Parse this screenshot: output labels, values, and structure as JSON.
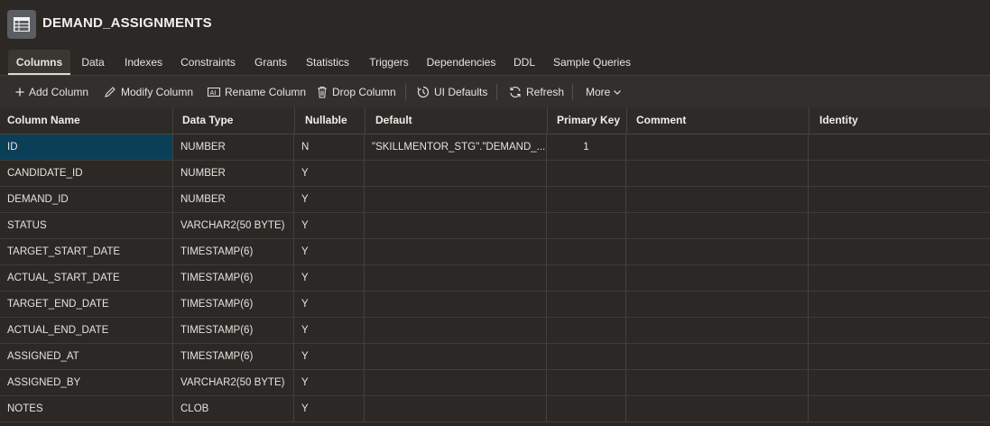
{
  "header": {
    "title": "DEMAND_ASSIGNMENTS",
    "icon": "table-icon"
  },
  "tabs": [
    "Columns",
    "Data",
    "Indexes",
    "Constraints",
    "Grants",
    "Statistics",
    "Triggers",
    "Dependencies",
    "DDL",
    "Sample Queries"
  ],
  "active_tab": "Columns",
  "toolbar": {
    "add_column": "Add Column",
    "modify_column": "Modify Column",
    "rename_column": "Rename Column",
    "drop_column": "Drop Column",
    "ui_defaults": "UI Defaults",
    "refresh": "Refresh",
    "more": "More"
  },
  "columns": [
    "Column Name",
    "Data Type",
    "Nullable",
    "Default",
    "Primary Key",
    "Comment",
    "Identity"
  ],
  "rows": [
    [
      "ID",
      "NUMBER",
      "N",
      "\"SKILLMENTOR_STG\".\"DEMAND_...",
      "1",
      "",
      ""
    ],
    [
      "CANDIDATE_ID",
      "NUMBER",
      "Y",
      "",
      "",
      "",
      ""
    ],
    [
      "DEMAND_ID",
      "NUMBER",
      "Y",
      "",
      "",
      "",
      ""
    ],
    [
      "STATUS",
      "VARCHAR2(50 BYTE)",
      "Y",
      "",
      "",
      "",
      ""
    ],
    [
      "TARGET_START_DATE",
      "TIMESTAMP(6)",
      "Y",
      "",
      "",
      "",
      ""
    ],
    [
      "ACTUAL_START_DATE",
      "TIMESTAMP(6)",
      "Y",
      "",
      "",
      "",
      ""
    ],
    [
      "TARGET_END_DATE",
      "TIMESTAMP(6)",
      "Y",
      "",
      "",
      "",
      ""
    ],
    [
      "ACTUAL_END_DATE",
      "TIMESTAMP(6)",
      "Y",
      "",
      "",
      "",
      ""
    ],
    [
      "ASSIGNED_AT",
      "TIMESTAMP(6)",
      "Y",
      "",
      "",
      "",
      ""
    ],
    [
      "ASSIGNED_BY",
      "VARCHAR2(50 BYTE)",
      "Y",
      "",
      "",
      "",
      ""
    ],
    [
      "NOTES",
      "CLOB",
      "Y",
      "",
      "",
      "",
      ""
    ]
  ],
  "colors": {
    "selected_cell": "#0b3f57",
    "background": "#2b2825",
    "toolbar": "#332f2c"
  }
}
